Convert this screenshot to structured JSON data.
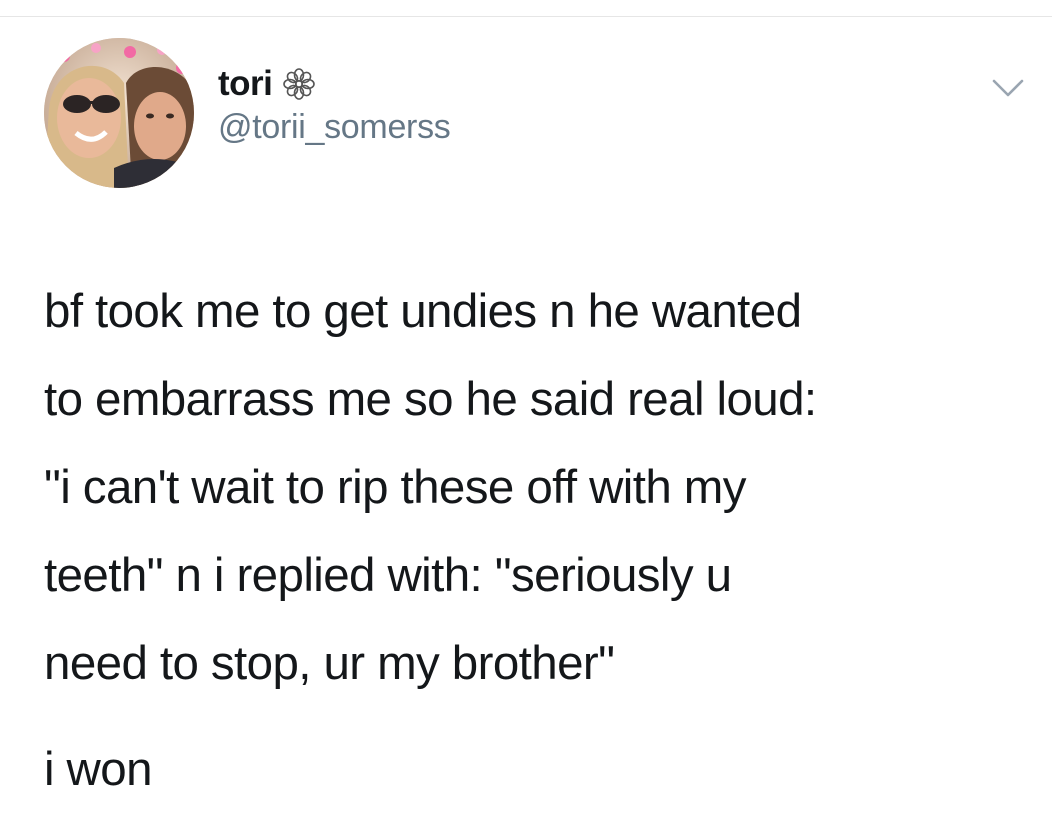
{
  "tweet": {
    "author": {
      "display_name": "tori",
      "name_icon": "flower-icon",
      "handle": "@torii_somerss",
      "avatar_icon": "profile-photo"
    },
    "menu_icon": "chevron-down-icon",
    "text_lines": [
      "bf took me to get undies n he wanted",
      "to embarrass me so he said real loud:",
      "\"i can't wait to rip these off with my",
      "teeth\" n i replied with: \"seriously u",
      "need to stop, ur my brother\""
    ],
    "text_tail": "i won"
  },
  "colors": {
    "text": "#14171a",
    "secondary_text": "#657786",
    "background": "#ffffff"
  }
}
